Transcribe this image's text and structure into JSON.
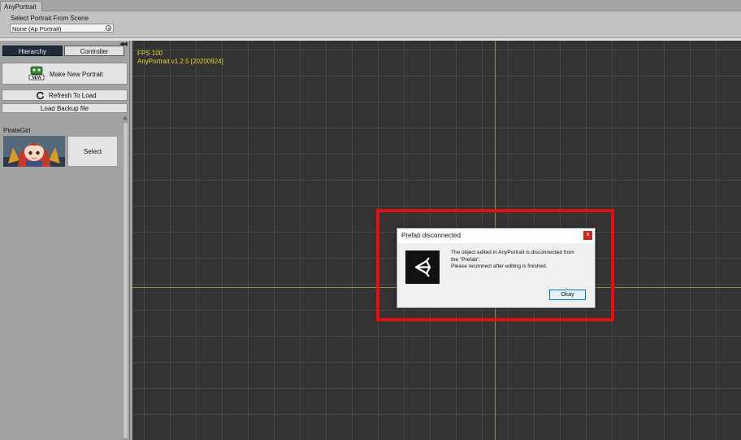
{
  "window": {
    "tab_label": "AnyPortrait"
  },
  "scene_selector": {
    "label": "Select Portrait From Scene",
    "value": "None (Ap Portrait)"
  },
  "sidebar": {
    "collapse_glyph": "◀◀",
    "tabs": [
      {
        "label": "Hierarchy",
        "selected": true
      },
      {
        "label": "Controller",
        "selected": false
      }
    ],
    "make_new_label": "Make New Portrait",
    "refresh_label": "Refresh To Load",
    "backup_label": "Load Backup file",
    "portraits": [
      {
        "name": "PirateGirl",
        "select_label": "Select"
      }
    ]
  },
  "viewport": {
    "fps_text": "FPS 100",
    "version_text": "AnyPortrait v1.2.5 [20200924]"
  },
  "dialog": {
    "title": "Prefab disconnected",
    "close_glyph": "x",
    "message_lines": [
      "The object edited in AnyPortrait is disconnected from",
      "the \"Prefab\".",
      "Please reconnect after editing is finished."
    ],
    "ok_label": "Okay"
  },
  "colors": {
    "highlight_frame": "#e01010",
    "viewport_text": "#e8d23a",
    "selected_tab": "#1e2b3a"
  }
}
